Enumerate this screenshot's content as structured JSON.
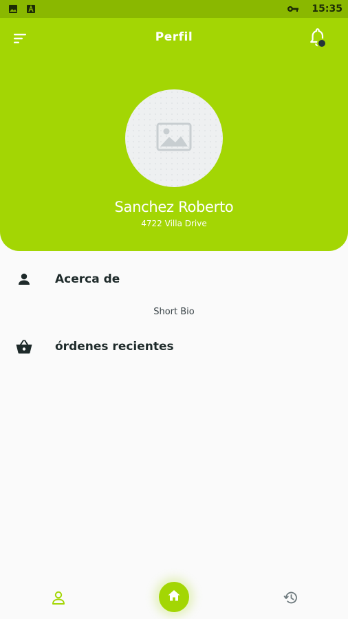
{
  "status_bar": {
    "time": "15:35",
    "left_icons": [
      "image-icon",
      "text-icon"
    ],
    "right_icons": [
      "key-icon"
    ]
  },
  "header": {
    "title": "Perfil",
    "menu_icon": "sort-menu-icon",
    "notification_icon": "bell-icon",
    "badge_count": ""
  },
  "profile": {
    "name": "Sanchez Roberto",
    "address": "4722 Villa Drive",
    "avatar_icon": "image-placeholder-icon"
  },
  "sections": {
    "about": {
      "label": "Acerca de",
      "icon": "person-icon"
    },
    "bio": "Short Bio",
    "orders": {
      "label": "órdenes recientes",
      "icon": "basket-icon"
    }
  },
  "bottom_nav": {
    "items": [
      {
        "icon": "person-outline-icon",
        "active": true
      },
      {
        "icon": "home-icon",
        "active": false
      },
      {
        "icon": "history-icon",
        "active": false
      }
    ]
  },
  "colors": {
    "accent": "#a3d604",
    "status_bar": "#8ab800",
    "background": "#fafafa",
    "text_dark": "#1e2a2a"
  }
}
